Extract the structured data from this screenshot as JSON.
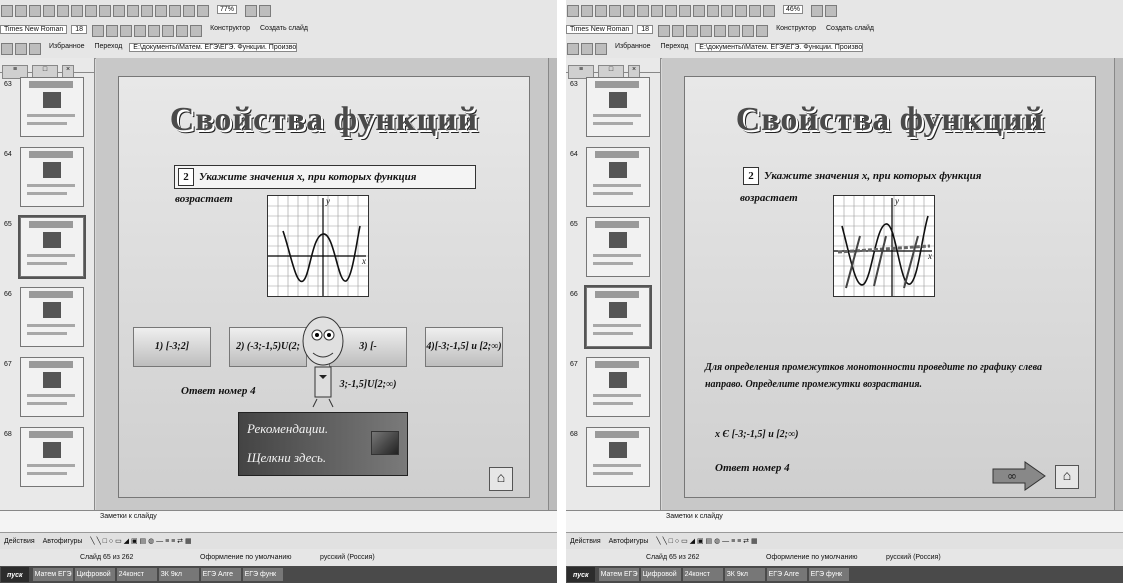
{
  "toolbar": {
    "font_name": "Times New Roman",
    "font_size": "18",
    "designer_label": "Конструктор",
    "new_slide_label": "Создать слайд",
    "favorites_label": "Избранное",
    "goto_label": "Переход",
    "path": "E:\\документы\\Матем. ЕГЭ\\ЕГЭ. Функции. Производная.ppt"
  },
  "left_window": {
    "zoom": "77%",
    "slide_title": "Свойства функций",
    "task_number": "2",
    "task_text": "Укажите значения х, при которых функция возрастает",
    "options": [
      "1)  [-3;2]",
      "2)  (-3;-1,5)U(2;",
      "3) [- 3;-1,5]U[2;∞)",
      "4)[-3;-1,5] и [2;∞)"
    ],
    "answer_text": "Ответ номер 4",
    "recommend_line1": "Рекомендации.",
    "recommend_line2": "Щелкни здесь."
  },
  "right_window": {
    "zoom": "46%",
    "slide_title": "Свойства функций",
    "task_number": "2",
    "task_text": "Укажите значения х, при которых функция возрастает",
    "explanation": "Для определения промежутков монотонности проведите по графику слева направо. Определите промежутки возрастания.",
    "solution": "х Є [-3;-1,5] и [2;∞)",
    "answer_text": "Ответ номер 4"
  },
  "graph": {
    "y_label": "y",
    "x_label": "x"
  },
  "thumbnails": [
    "63",
    "64",
    "65",
    "66",
    "67",
    "68"
  ],
  "notes_placeholder": "Заметки к слайду",
  "drawing": {
    "actions": "Действия",
    "autoshapes": "Автофигуры"
  },
  "status": {
    "slide": "Слайд 65 из 262",
    "design": "Оформление по умолчанию",
    "language": "русский (Россия)"
  },
  "taskbar": {
    "start": "пуск",
    "items": [
      "Матем ЕГЭ",
      "Цифровой",
      "24конст",
      "ЗК 9кл",
      "ЕГЭ Алге",
      "ЕГЭ функ"
    ]
  }
}
